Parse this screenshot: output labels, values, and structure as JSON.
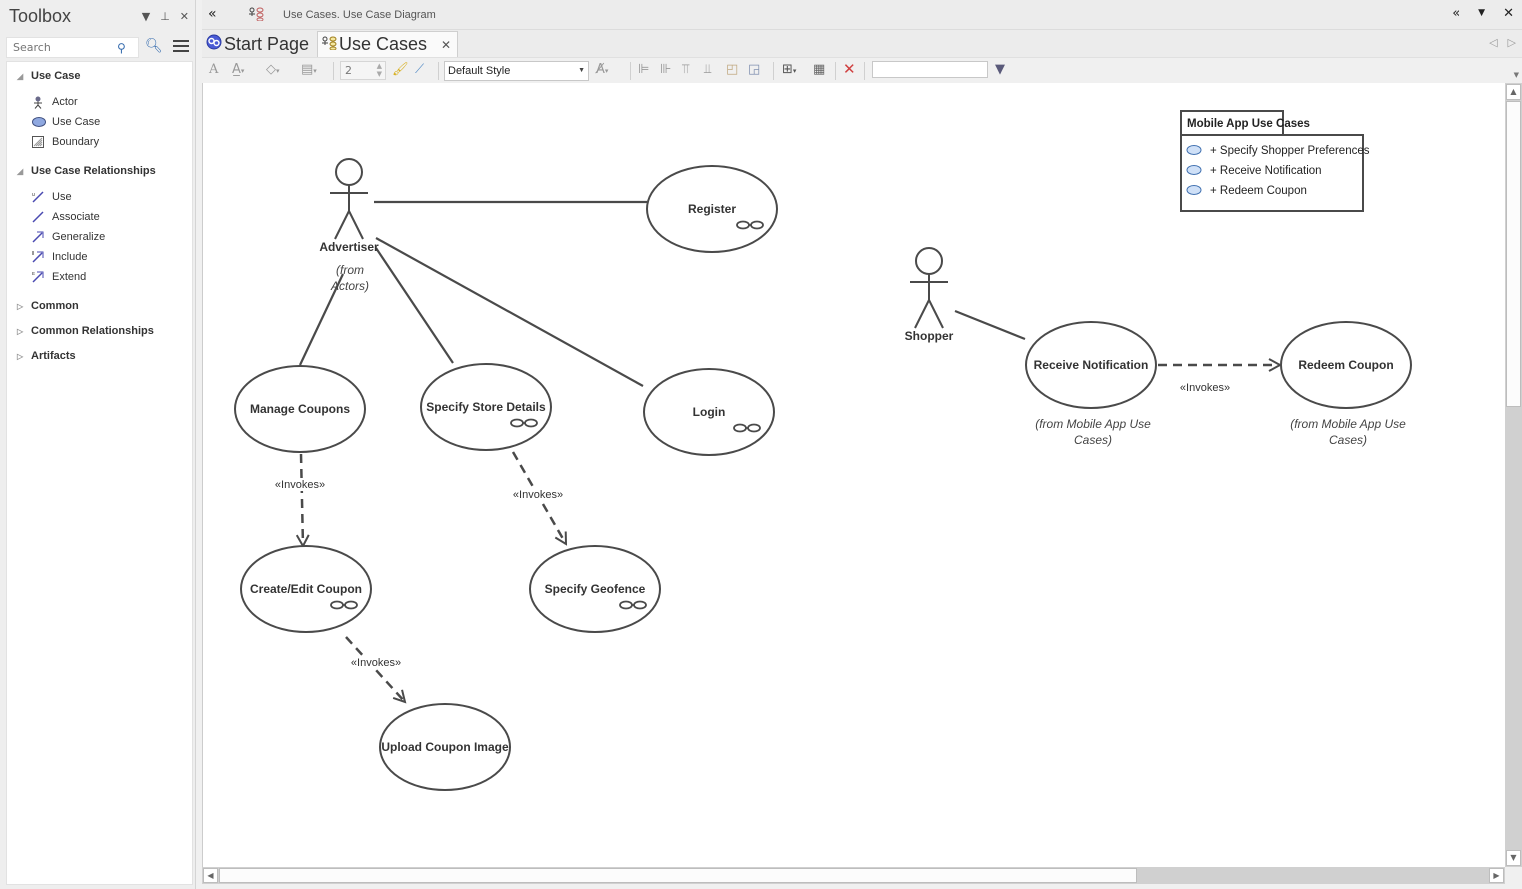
{
  "toolbox": {
    "title": "Toolbox",
    "search_placeholder": "Search",
    "groups": [
      {
        "label": "Use Case",
        "expanded": true,
        "items": [
          {
            "label": "Actor",
            "icon": "actor-icon"
          },
          {
            "label": "Use Case",
            "icon": "use-case-icon"
          },
          {
            "label": "Boundary",
            "icon": "boundary-icon"
          }
        ]
      },
      {
        "label": "Use Case Relationships",
        "expanded": true,
        "items": [
          {
            "label": "Use",
            "icon": "use-relationship-icon"
          },
          {
            "label": "Associate",
            "icon": "associate-icon"
          },
          {
            "label": "Generalize",
            "icon": "generalize-icon"
          },
          {
            "label": "Include",
            "icon": "include-icon"
          },
          {
            "label": "Extend",
            "icon": "extend-icon"
          }
        ]
      },
      {
        "label": "Common",
        "expanded": false
      },
      {
        "label": "Common Relationships",
        "expanded": false
      },
      {
        "label": "Artifacts",
        "expanded": false
      }
    ]
  },
  "header": {
    "path": "Use Cases.  Use Case Diagram"
  },
  "tabs": [
    {
      "label": "Start Page",
      "active": false
    },
    {
      "label": "Use Cases",
      "active": true
    }
  ],
  "toolbar": {
    "line_width": "2",
    "style": "Default Style",
    "find_value": ""
  },
  "diagram": {
    "actors": [
      {
        "name": "Advertiser",
        "note": [
          "(from",
          "Actors)"
        ]
      },
      {
        "name": "Shopper"
      }
    ],
    "use_cases": [
      {
        "id": "register",
        "name": "Register",
        "composite": true
      },
      {
        "id": "manage",
        "name": "Manage Coupons",
        "composite": false
      },
      {
        "id": "store",
        "name": "Specify Store Details",
        "composite": true
      },
      {
        "id": "login",
        "name": "Login",
        "composite": true
      },
      {
        "id": "create",
        "name": "Create/Edit Coupon",
        "composite": true
      },
      {
        "id": "geofence",
        "name": "Specify Geofence",
        "composite": true
      },
      {
        "id": "upload",
        "name": "Upload Coupon Image",
        "composite": false
      },
      {
        "id": "receive",
        "name": "Receive Notification",
        "composite": false,
        "note": [
          "(from Mobile App Use",
          "Cases)"
        ]
      },
      {
        "id": "redeem",
        "name": "Redeem Coupon",
        "composite": false,
        "note": [
          "(from Mobile App Use",
          "Cases)"
        ]
      }
    ],
    "stereotype": "«Invokes»",
    "package": {
      "name": "Mobile App Use Cases",
      "members": [
        "+ Specify Shopper Preferences",
        "+ Receive Notification",
        "+ Redeem Coupon"
      ]
    }
  },
  "colors": {
    "line": "#4a4a4a",
    "package_member_icon": "#cfe0f7"
  }
}
